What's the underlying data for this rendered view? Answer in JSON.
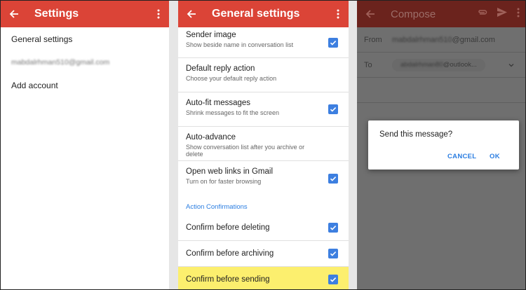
{
  "settings": {
    "title": "Settings",
    "items": [
      {
        "label": "General settings"
      },
      {
        "label": "mabdalrhman510@gmail.com"
      },
      {
        "label": "Add account"
      }
    ]
  },
  "general": {
    "title": "General settings",
    "rows": [
      {
        "title": "Sender image",
        "subtitle": "Show beside name in conversation list",
        "checked": true
      },
      {
        "title": "Default reply action",
        "subtitle": "Choose your default reply action",
        "checked": false
      },
      {
        "title": "Auto-fit messages",
        "subtitle": "Shrink messages to fit the screen",
        "checked": true
      },
      {
        "title": "Auto-advance",
        "subtitle": "Show conversation list after you archive or delete",
        "checked": false
      },
      {
        "title": "Open web links in Gmail",
        "subtitle": "Turn on for faster browsing",
        "checked": true
      }
    ],
    "section_label": "Action Confirmations",
    "confirm_rows": [
      {
        "title": "Confirm before deleting",
        "checked": true
      },
      {
        "title": "Confirm before archiving",
        "checked": true
      },
      {
        "title": "Confirm before sending",
        "checked": true
      }
    ]
  },
  "compose": {
    "title": "Compose",
    "from_label": "From",
    "from_user": "mabdalrhman510",
    "from_domain": "@gmail.com",
    "to_label": "To",
    "to_user": "abdalrhman80",
    "to_domain": "@outlook...",
    "dialog": {
      "question": "Send this message?",
      "cancel": "CANCEL",
      "ok": "OK"
    }
  },
  "colors": {
    "appbar": "#db4437",
    "accent": "#2a7de1",
    "highlight": "#fcef6e",
    "checkbox": "#3d7fe0"
  },
  "icons": [
    "back-arrow-icon",
    "more-vert-icon",
    "attach-icon",
    "send-icon",
    "checkbox-icon",
    "chevron-down-icon"
  ]
}
